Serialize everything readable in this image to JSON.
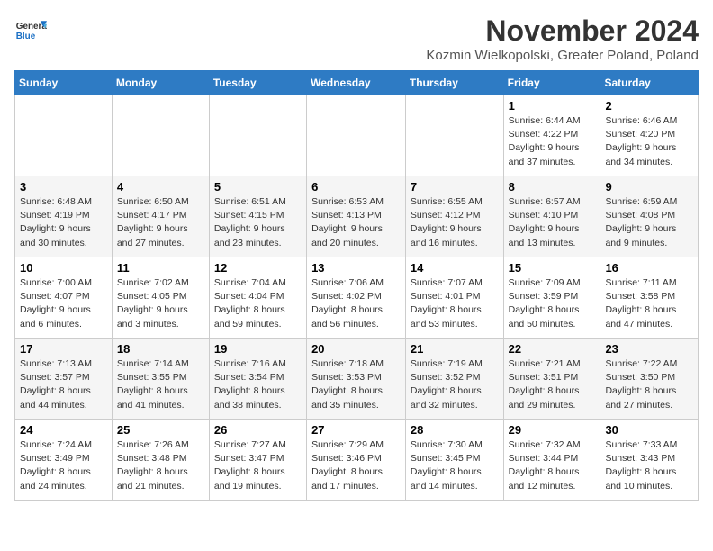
{
  "logo": {
    "line1": "General",
    "line2": "Blue"
  },
  "title": "November 2024",
  "subtitle": "Kozmin Wielkopolski, Greater Poland, Poland",
  "days_of_week": [
    "Sunday",
    "Monday",
    "Tuesday",
    "Wednesday",
    "Thursday",
    "Friday",
    "Saturday"
  ],
  "weeks": [
    [
      {
        "day": "",
        "info": ""
      },
      {
        "day": "",
        "info": ""
      },
      {
        "day": "",
        "info": ""
      },
      {
        "day": "",
        "info": ""
      },
      {
        "day": "",
        "info": ""
      },
      {
        "day": "1",
        "info": "Sunrise: 6:44 AM\nSunset: 4:22 PM\nDaylight: 9 hours\nand 37 minutes."
      },
      {
        "day": "2",
        "info": "Sunrise: 6:46 AM\nSunset: 4:20 PM\nDaylight: 9 hours\nand 34 minutes."
      }
    ],
    [
      {
        "day": "3",
        "info": "Sunrise: 6:48 AM\nSunset: 4:19 PM\nDaylight: 9 hours\nand 30 minutes."
      },
      {
        "day": "4",
        "info": "Sunrise: 6:50 AM\nSunset: 4:17 PM\nDaylight: 9 hours\nand 27 minutes."
      },
      {
        "day": "5",
        "info": "Sunrise: 6:51 AM\nSunset: 4:15 PM\nDaylight: 9 hours\nand 23 minutes."
      },
      {
        "day": "6",
        "info": "Sunrise: 6:53 AM\nSunset: 4:13 PM\nDaylight: 9 hours\nand 20 minutes."
      },
      {
        "day": "7",
        "info": "Sunrise: 6:55 AM\nSunset: 4:12 PM\nDaylight: 9 hours\nand 16 minutes."
      },
      {
        "day": "8",
        "info": "Sunrise: 6:57 AM\nSunset: 4:10 PM\nDaylight: 9 hours\nand 13 minutes."
      },
      {
        "day": "9",
        "info": "Sunrise: 6:59 AM\nSunset: 4:08 PM\nDaylight: 9 hours\nand 9 minutes."
      }
    ],
    [
      {
        "day": "10",
        "info": "Sunrise: 7:00 AM\nSunset: 4:07 PM\nDaylight: 9 hours\nand 6 minutes."
      },
      {
        "day": "11",
        "info": "Sunrise: 7:02 AM\nSunset: 4:05 PM\nDaylight: 9 hours\nand 3 minutes."
      },
      {
        "day": "12",
        "info": "Sunrise: 7:04 AM\nSunset: 4:04 PM\nDaylight: 8 hours\nand 59 minutes."
      },
      {
        "day": "13",
        "info": "Sunrise: 7:06 AM\nSunset: 4:02 PM\nDaylight: 8 hours\nand 56 minutes."
      },
      {
        "day": "14",
        "info": "Sunrise: 7:07 AM\nSunset: 4:01 PM\nDaylight: 8 hours\nand 53 minutes."
      },
      {
        "day": "15",
        "info": "Sunrise: 7:09 AM\nSunset: 3:59 PM\nDaylight: 8 hours\nand 50 minutes."
      },
      {
        "day": "16",
        "info": "Sunrise: 7:11 AM\nSunset: 3:58 PM\nDaylight: 8 hours\nand 47 minutes."
      }
    ],
    [
      {
        "day": "17",
        "info": "Sunrise: 7:13 AM\nSunset: 3:57 PM\nDaylight: 8 hours\nand 44 minutes."
      },
      {
        "day": "18",
        "info": "Sunrise: 7:14 AM\nSunset: 3:55 PM\nDaylight: 8 hours\nand 41 minutes."
      },
      {
        "day": "19",
        "info": "Sunrise: 7:16 AM\nSunset: 3:54 PM\nDaylight: 8 hours\nand 38 minutes."
      },
      {
        "day": "20",
        "info": "Sunrise: 7:18 AM\nSunset: 3:53 PM\nDaylight: 8 hours\nand 35 minutes."
      },
      {
        "day": "21",
        "info": "Sunrise: 7:19 AM\nSunset: 3:52 PM\nDaylight: 8 hours\nand 32 minutes."
      },
      {
        "day": "22",
        "info": "Sunrise: 7:21 AM\nSunset: 3:51 PM\nDaylight: 8 hours\nand 29 minutes."
      },
      {
        "day": "23",
        "info": "Sunrise: 7:22 AM\nSunset: 3:50 PM\nDaylight: 8 hours\nand 27 minutes."
      }
    ],
    [
      {
        "day": "24",
        "info": "Sunrise: 7:24 AM\nSunset: 3:49 PM\nDaylight: 8 hours\nand 24 minutes."
      },
      {
        "day": "25",
        "info": "Sunrise: 7:26 AM\nSunset: 3:48 PM\nDaylight: 8 hours\nand 21 minutes."
      },
      {
        "day": "26",
        "info": "Sunrise: 7:27 AM\nSunset: 3:47 PM\nDaylight: 8 hours\nand 19 minutes."
      },
      {
        "day": "27",
        "info": "Sunrise: 7:29 AM\nSunset: 3:46 PM\nDaylight: 8 hours\nand 17 minutes."
      },
      {
        "day": "28",
        "info": "Sunrise: 7:30 AM\nSunset: 3:45 PM\nDaylight: 8 hours\nand 14 minutes."
      },
      {
        "day": "29",
        "info": "Sunrise: 7:32 AM\nSunset: 3:44 PM\nDaylight: 8 hours\nand 12 minutes."
      },
      {
        "day": "30",
        "info": "Sunrise: 7:33 AM\nSunset: 3:43 PM\nDaylight: 8 hours\nand 10 minutes."
      }
    ]
  ]
}
